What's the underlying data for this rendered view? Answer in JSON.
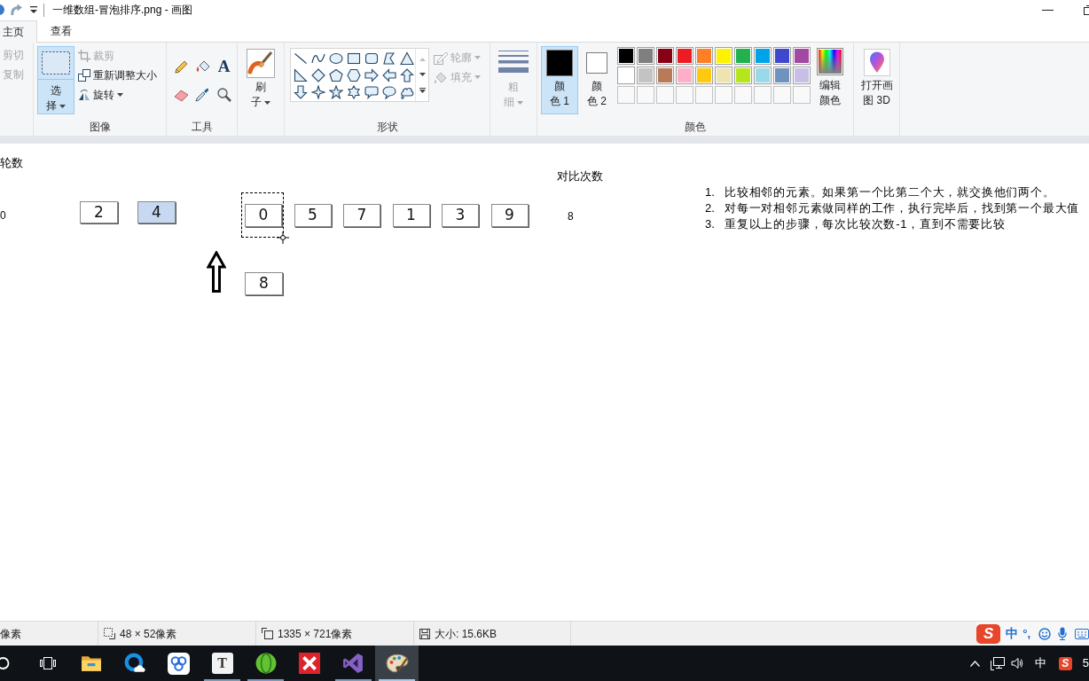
{
  "title_bar": {
    "title": "一维数组-冒泡排序.png - 画图"
  },
  "tabs": [
    {
      "label": "主页",
      "selected": true
    },
    {
      "label": "查看",
      "selected": false
    }
  ],
  "ribbon": {
    "clipboard": {
      "commands": [
        {
          "label": "剪切",
          "disabled": true
        },
        {
          "label": "复制",
          "disabled": true
        }
      ]
    },
    "image": {
      "label": "图像",
      "select_button": {
        "label": "选择",
        "selected": true
      },
      "commands": [
        {
          "kind": "crop",
          "label": "裁剪",
          "disabled": true
        },
        {
          "kind": "resize",
          "label": "重新调整大小",
          "disabled": false
        },
        {
          "kind": "rotate",
          "label": "旋转",
          "disabled": false
        }
      ]
    },
    "tools": {
      "label": "工具",
      "text_tool": "A"
    },
    "brush": {
      "label": "刷子"
    },
    "shapes": {
      "label": "形状",
      "commands": [
        {
          "kind": "outline",
          "label": "轮廓",
          "disabled": true
        },
        {
          "kind": "fill",
          "label": "填充",
          "disabled": true
        }
      ]
    },
    "size": {
      "label": "粗细",
      "disabled": true
    },
    "colors": {
      "label": "颜色",
      "slots": [
        {
          "label": "颜色 1",
          "color": "#000000",
          "selected": true
        },
        {
          "label": "颜色 2",
          "color": "#ffffff",
          "selected": false
        }
      ],
      "palette": [
        {
          "kind": "swatch",
          "color": "#000000"
        },
        {
          "kind": "swatch",
          "color": "#7f7f7f"
        },
        {
          "kind": "swatch",
          "color": "#880015"
        },
        {
          "kind": "swatch",
          "color": "#ed1c24"
        },
        {
          "kind": "swatch",
          "color": "#ff7f27"
        },
        {
          "kind": "swatch",
          "color": "#fff200"
        },
        {
          "kind": "swatch",
          "color": "#22b14c"
        },
        {
          "kind": "swatch",
          "color": "#00a2e8"
        },
        {
          "kind": "swatch",
          "color": "#3f48cc"
        },
        {
          "kind": "swatch",
          "color": "#a349a4"
        },
        {
          "kind": "swatch",
          "color": "#ffffff"
        },
        {
          "kind": "swatch",
          "color": "#c3c3c3"
        },
        {
          "kind": "swatch",
          "color": "#b97a57"
        },
        {
          "kind": "swatch",
          "color": "#ffaec9"
        },
        {
          "kind": "swatch",
          "color": "#ffc90e"
        },
        {
          "kind": "swatch",
          "color": "#efe4b0"
        },
        {
          "kind": "swatch",
          "color": "#b5e61d"
        },
        {
          "kind": "swatch",
          "color": "#99d9ea"
        },
        {
          "kind": "swatch",
          "color": "#7092be"
        },
        {
          "kind": "swatch",
          "color": "#c8bfe7"
        },
        {
          "kind": "empty"
        },
        {
          "kind": "empty"
        },
        {
          "kind": "empty"
        },
        {
          "kind": "empty"
        },
        {
          "kind": "empty"
        },
        {
          "kind": "empty"
        },
        {
          "kind": "empty"
        },
        {
          "kind": "empty"
        },
        {
          "kind": "empty"
        },
        {
          "kind": "empty"
        }
      ],
      "edit_button": {
        "label": "编辑颜色"
      }
    },
    "paint_3d": {
      "label": "打开画图 3D"
    }
  },
  "canvas": {
    "round_label": "轮数",
    "round_value": "0",
    "done_boxes": [
      {
        "value": "2",
        "highlighted": false
      },
      {
        "value": "4",
        "highlighted": true
      }
    ],
    "array_boxes": [
      {
        "value": "0",
        "selected": true
      },
      {
        "value": "5",
        "selected": false
      },
      {
        "value": "7",
        "selected": false
      },
      {
        "value": "1",
        "selected": false
      },
      {
        "value": "3",
        "selected": false
      },
      {
        "value": "9",
        "selected": false
      }
    ],
    "temp_box": {
      "value": "8"
    },
    "compare_label": "对比次数",
    "compare_value": "8",
    "steps": [
      {
        "number": "1.",
        "text": "比较相邻的元素。如果第一个比第二个大，就交换他们两个。"
      },
      {
        "number": "2.",
        "text": "对每一对相邻元素做同样的工作，执行完毕后，找到第一个最大值"
      },
      {
        "number": "3.",
        "text": "重复以上的步骤，每次比较次数-1，直到不需要比较"
      }
    ]
  },
  "status_bar": {
    "cursor_position": "像素",
    "selection_size": "48 × 52像素",
    "image_size": "1335 × 721像素",
    "file_size": "大小: 15.6KB"
  },
  "ime_toolbar": {
    "logo": "S",
    "mode": "中",
    "punctuation": "°,"
  },
  "taskbar": {
    "buttons": [
      {
        "kind": "search",
        "running": false,
        "active": false
      },
      {
        "kind": "task_view",
        "running": false,
        "active": false
      },
      {
        "kind": "folder",
        "running": false,
        "active": false
      },
      {
        "kind": "blue_ring",
        "running": false,
        "active": false
      },
      {
        "kind": "rings",
        "running": false,
        "active": false
      },
      {
        "kind": "letter",
        "label": "T",
        "running": true,
        "active": false
      },
      {
        "kind": "sphere",
        "running": true,
        "active": false
      },
      {
        "kind": "cross",
        "running": false,
        "active": false
      },
      {
        "kind": "loop",
        "running": true,
        "active": false
      },
      {
        "kind": "palette",
        "running": true,
        "active": true
      }
    ],
    "tray": {
      "ime_mode": "中",
      "ime_logo": "S",
      "clock": "5"
    }
  }
}
